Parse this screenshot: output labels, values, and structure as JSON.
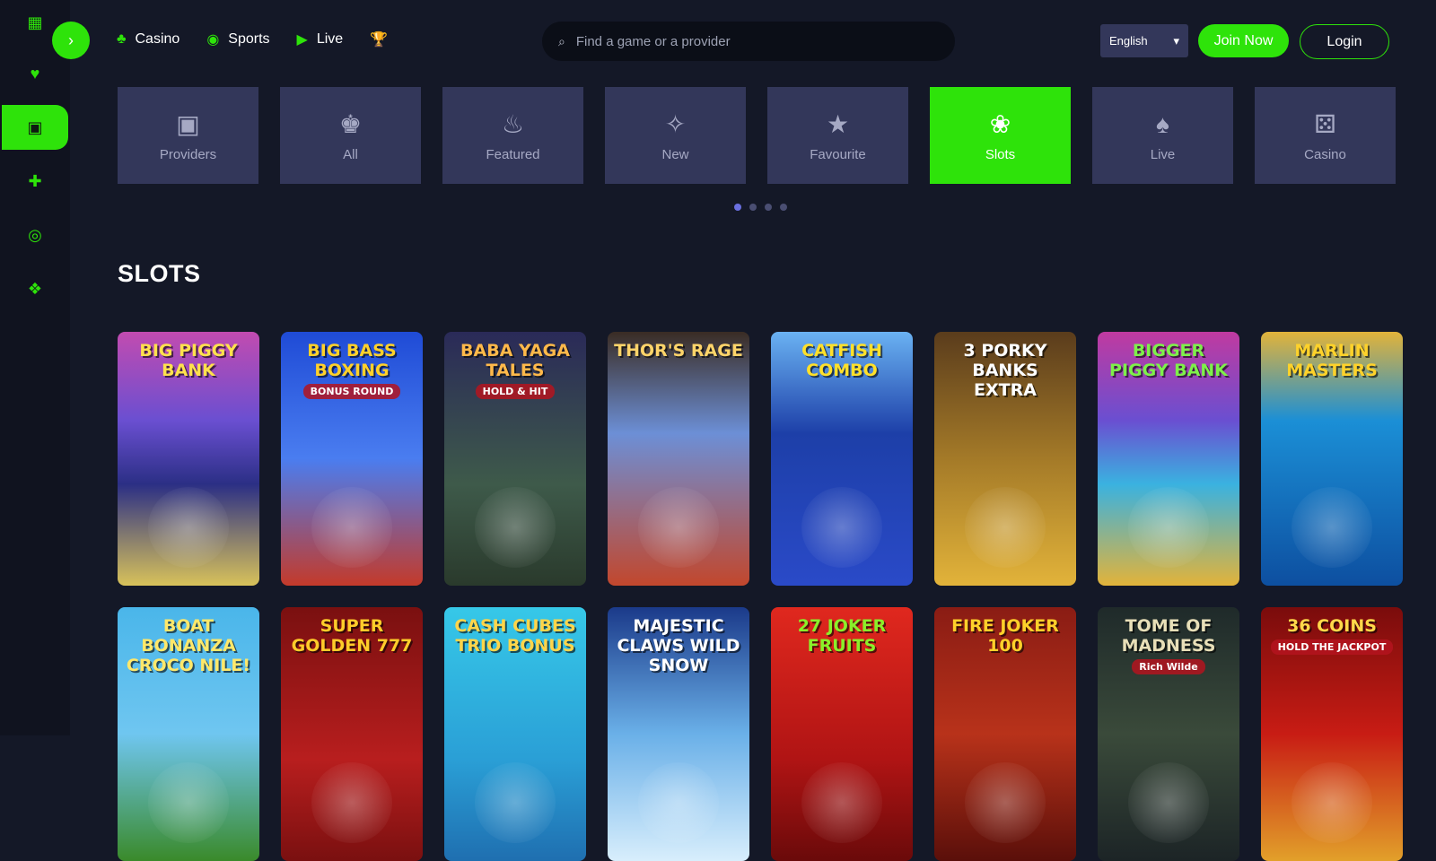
{
  "sidebar": {
    "items": [
      {
        "name": "dashboard-icon",
        "glyph": "▦"
      },
      {
        "name": "heart-icon",
        "glyph": "♥"
      },
      {
        "name": "slot-machine-icon",
        "glyph": "▣"
      },
      {
        "name": "gift-icon",
        "glyph": "✚"
      },
      {
        "name": "target-icon",
        "glyph": "◎"
      },
      {
        "name": "chat-icon",
        "glyph": "❖"
      }
    ]
  },
  "header": {
    "nav": [
      {
        "label": "Casino",
        "icon": "♣"
      },
      {
        "label": "Sports",
        "icon": "◉"
      },
      {
        "label": "Live",
        "icon": "▶"
      },
      {
        "label": "",
        "icon": "🏆"
      }
    ],
    "search": {
      "placeholder": "Find a game or a provider",
      "icon": "⌕"
    },
    "language": "English",
    "join_label": "Join Now",
    "login_label": "Login",
    "toggle_icon": "›"
  },
  "categories": [
    {
      "label": "Providers",
      "icon": "▣",
      "active": false
    },
    {
      "label": "All",
      "icon": "♚",
      "active": false
    },
    {
      "label": "Featured",
      "icon": "♨",
      "active": false
    },
    {
      "label": "New",
      "icon": "✧",
      "active": false
    },
    {
      "label": "Favourite",
      "icon": "★",
      "active": false
    },
    {
      "label": "Slots",
      "icon": "❀",
      "active": true
    },
    {
      "label": "Live",
      "icon": "♠",
      "active": false
    },
    {
      "label": "Casino",
      "icon": "⚄",
      "active": false
    }
  ],
  "carousel": {
    "pages": 4,
    "active": 0
  },
  "section_title": "SLOTS",
  "games": [
    {
      "title": "BIG PIGGY BANK",
      "sub": "",
      "bg": "linear-gradient(180deg,#c24bb0 0%,#6a4fd1 35%,#2b2f85 60%,#d8c25a 100%)",
      "color": "#ffe14d"
    },
    {
      "title": "BIG BASS BOXING",
      "sub": "BONUS ROUND",
      "bg": "linear-gradient(180deg,#1f4bd6 0%,#4a7df0 50%,#c43a2a 100%)",
      "color": "#ffd12a"
    },
    {
      "title": "BABA YAGA TALES",
      "sub": "HOLD & HIT",
      "bg": "linear-gradient(180deg,#2a2a58 0%,#3e5a4a 60%,#2a3a2c 100%)",
      "color": "#ffb94a"
    },
    {
      "title": "THOR'S RAGE",
      "sub": "",
      "bg": "linear-gradient(180deg,#3a2c24 0%,#6c8fd6 40%,#c2472d 100%)",
      "color": "#ffd46a"
    },
    {
      "title": "CATFISH COMBO",
      "sub": "",
      "bg": "linear-gradient(180deg,#6ab2f2 0%,#1d3fa8 40%,#2a4ac8 100%)",
      "color": "#ffe02a"
    },
    {
      "title": "3 PORKY BANKS EXTRA",
      "sub": "",
      "bg": "linear-gradient(180deg,#5a3c1c 0%,#a47a28 50%,#e2b33a 100%)",
      "color": "#ffffff"
    },
    {
      "title": "BIGGER PIGGY BANK",
      "sub": "",
      "bg": "linear-gradient(180deg,#c03aa0 0%,#6a4fd1 35%,#3ab2e0 60%,#e2b33a 100%)",
      "color": "#7ef04a"
    },
    {
      "title": "MARLIN MASTERS",
      "sub": "",
      "bg": "linear-gradient(180deg,#e2b33a 0%,#1b8fd6 35%,#0d4fa0 100%)",
      "color": "#ffd22a"
    },
    {
      "title": "BOAT BONANZA CROCO NILE!",
      "sub": "",
      "bg": "linear-gradient(180deg,#4ab6ea 0%,#6fc6f0 50%,#3a8a2a 100%)",
      "color": "#ffe86a"
    },
    {
      "title": "SUPER GOLDEN 777",
      "sub": "",
      "bg": "linear-gradient(180deg,#7a1010 0%,#b81e1e 60%,#7a1010 100%)",
      "color": "#ffcc2a"
    },
    {
      "title": "CASH CUBES TRIO BONUS",
      "sub": "",
      "bg": "linear-gradient(180deg,#36c8e8 0%,#2a9fd6 60%,#1f6fb0 100%)",
      "color": "#ffd54a"
    },
    {
      "title": "MAJESTIC CLAWS WILD SNOW",
      "sub": "",
      "bg": "linear-gradient(180deg,#1b3a8a 0%,#6ab0e8 50%,#d8eefc 100%)",
      "color": "#ffffff"
    },
    {
      "title": "27 JOKER FRUITS",
      "sub": "",
      "bg": "linear-gradient(180deg,#e0281e 0%,#b01414 60%,#6a0a0a 100%)",
      "color": "#8af02a"
    },
    {
      "title": "FIRE JOKER 100",
      "sub": "",
      "bg": "linear-gradient(180deg,#8a1c14 0%,#b8321a 50%,#5a0f0a 100%)",
      "color": "#ffd02a"
    },
    {
      "title": "TOME OF MADNESS",
      "sub": "Rich Wilde",
      "bg": "linear-gradient(180deg,#1f2a2a 0%,#3a4a3a 50%,#1c2426 100%)",
      "color": "#e8dfb8"
    },
    {
      "title": "36 COINS",
      "sub": "HOLD THE JACKPOT",
      "bg": "linear-gradient(180deg,#7a0c0c 0%,#c81c14 50%,#e2a02a 100%)",
      "color": "#ffd84a"
    }
  ]
}
